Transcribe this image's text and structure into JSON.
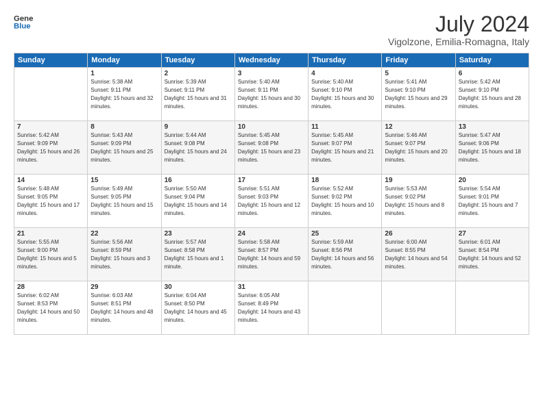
{
  "logo": {
    "line1": "General",
    "line2": "Blue"
  },
  "title": "July 2024",
  "location": "Vigolzone, Emilia-Romagna, Italy",
  "weekdays": [
    "Sunday",
    "Monday",
    "Tuesday",
    "Wednesday",
    "Thursday",
    "Friday",
    "Saturday"
  ],
  "weeks": [
    [
      {
        "day": "",
        "sunrise": "",
        "sunset": "",
        "daylight": ""
      },
      {
        "day": "1",
        "sunrise": "Sunrise: 5:38 AM",
        "sunset": "Sunset: 9:11 PM",
        "daylight": "Daylight: 15 hours and 32 minutes."
      },
      {
        "day": "2",
        "sunrise": "Sunrise: 5:39 AM",
        "sunset": "Sunset: 9:11 PM",
        "daylight": "Daylight: 15 hours and 31 minutes."
      },
      {
        "day": "3",
        "sunrise": "Sunrise: 5:40 AM",
        "sunset": "Sunset: 9:11 PM",
        "daylight": "Daylight: 15 hours and 30 minutes."
      },
      {
        "day": "4",
        "sunrise": "Sunrise: 5:40 AM",
        "sunset": "Sunset: 9:10 PM",
        "daylight": "Daylight: 15 hours and 30 minutes."
      },
      {
        "day": "5",
        "sunrise": "Sunrise: 5:41 AM",
        "sunset": "Sunset: 9:10 PM",
        "daylight": "Daylight: 15 hours and 29 minutes."
      },
      {
        "day": "6",
        "sunrise": "Sunrise: 5:42 AM",
        "sunset": "Sunset: 9:10 PM",
        "daylight": "Daylight: 15 hours and 28 minutes."
      }
    ],
    [
      {
        "day": "7",
        "sunrise": "Sunrise: 5:42 AM",
        "sunset": "Sunset: 9:09 PM",
        "daylight": "Daylight: 15 hours and 26 minutes."
      },
      {
        "day": "8",
        "sunrise": "Sunrise: 5:43 AM",
        "sunset": "Sunset: 9:09 PM",
        "daylight": "Daylight: 15 hours and 25 minutes."
      },
      {
        "day": "9",
        "sunrise": "Sunrise: 5:44 AM",
        "sunset": "Sunset: 9:08 PM",
        "daylight": "Daylight: 15 hours and 24 minutes."
      },
      {
        "day": "10",
        "sunrise": "Sunrise: 5:45 AM",
        "sunset": "Sunset: 9:08 PM",
        "daylight": "Daylight: 15 hours and 23 minutes."
      },
      {
        "day": "11",
        "sunrise": "Sunrise: 5:45 AM",
        "sunset": "Sunset: 9:07 PM",
        "daylight": "Daylight: 15 hours and 21 minutes."
      },
      {
        "day": "12",
        "sunrise": "Sunrise: 5:46 AM",
        "sunset": "Sunset: 9:07 PM",
        "daylight": "Daylight: 15 hours and 20 minutes."
      },
      {
        "day": "13",
        "sunrise": "Sunrise: 5:47 AM",
        "sunset": "Sunset: 9:06 PM",
        "daylight": "Daylight: 15 hours and 18 minutes."
      }
    ],
    [
      {
        "day": "14",
        "sunrise": "Sunrise: 5:48 AM",
        "sunset": "Sunset: 9:05 PM",
        "daylight": "Daylight: 15 hours and 17 minutes."
      },
      {
        "day": "15",
        "sunrise": "Sunrise: 5:49 AM",
        "sunset": "Sunset: 9:05 PM",
        "daylight": "Daylight: 15 hours and 15 minutes."
      },
      {
        "day": "16",
        "sunrise": "Sunrise: 5:50 AM",
        "sunset": "Sunset: 9:04 PM",
        "daylight": "Daylight: 15 hours and 14 minutes."
      },
      {
        "day": "17",
        "sunrise": "Sunrise: 5:51 AM",
        "sunset": "Sunset: 9:03 PM",
        "daylight": "Daylight: 15 hours and 12 minutes."
      },
      {
        "day": "18",
        "sunrise": "Sunrise: 5:52 AM",
        "sunset": "Sunset: 9:02 PM",
        "daylight": "Daylight: 15 hours and 10 minutes."
      },
      {
        "day": "19",
        "sunrise": "Sunrise: 5:53 AM",
        "sunset": "Sunset: 9:02 PM",
        "daylight": "Daylight: 15 hours and 8 minutes."
      },
      {
        "day": "20",
        "sunrise": "Sunrise: 5:54 AM",
        "sunset": "Sunset: 9:01 PM",
        "daylight": "Daylight: 15 hours and 7 minutes."
      }
    ],
    [
      {
        "day": "21",
        "sunrise": "Sunrise: 5:55 AM",
        "sunset": "Sunset: 9:00 PM",
        "daylight": "Daylight: 15 hours and 5 minutes."
      },
      {
        "day": "22",
        "sunrise": "Sunrise: 5:56 AM",
        "sunset": "Sunset: 8:59 PM",
        "daylight": "Daylight: 15 hours and 3 minutes."
      },
      {
        "day": "23",
        "sunrise": "Sunrise: 5:57 AM",
        "sunset": "Sunset: 8:58 PM",
        "daylight": "Daylight: 15 hours and 1 minute."
      },
      {
        "day": "24",
        "sunrise": "Sunrise: 5:58 AM",
        "sunset": "Sunset: 8:57 PM",
        "daylight": "Daylight: 14 hours and 59 minutes."
      },
      {
        "day": "25",
        "sunrise": "Sunrise: 5:59 AM",
        "sunset": "Sunset: 8:56 PM",
        "daylight": "Daylight: 14 hours and 56 minutes."
      },
      {
        "day": "26",
        "sunrise": "Sunrise: 6:00 AM",
        "sunset": "Sunset: 8:55 PM",
        "daylight": "Daylight: 14 hours and 54 minutes."
      },
      {
        "day": "27",
        "sunrise": "Sunrise: 6:01 AM",
        "sunset": "Sunset: 8:54 PM",
        "daylight": "Daylight: 14 hours and 52 minutes."
      }
    ],
    [
      {
        "day": "28",
        "sunrise": "Sunrise: 6:02 AM",
        "sunset": "Sunset: 8:53 PM",
        "daylight": "Daylight: 14 hours and 50 minutes."
      },
      {
        "day": "29",
        "sunrise": "Sunrise: 6:03 AM",
        "sunset": "Sunset: 8:51 PM",
        "daylight": "Daylight: 14 hours and 48 minutes."
      },
      {
        "day": "30",
        "sunrise": "Sunrise: 6:04 AM",
        "sunset": "Sunset: 8:50 PM",
        "daylight": "Daylight: 14 hours and 45 minutes."
      },
      {
        "day": "31",
        "sunrise": "Sunrise: 6:05 AM",
        "sunset": "Sunset: 8:49 PM",
        "daylight": "Daylight: 14 hours and 43 minutes."
      },
      {
        "day": "",
        "sunrise": "",
        "sunset": "",
        "daylight": ""
      },
      {
        "day": "",
        "sunrise": "",
        "sunset": "",
        "daylight": ""
      },
      {
        "day": "",
        "sunrise": "",
        "sunset": "",
        "daylight": ""
      }
    ]
  ]
}
